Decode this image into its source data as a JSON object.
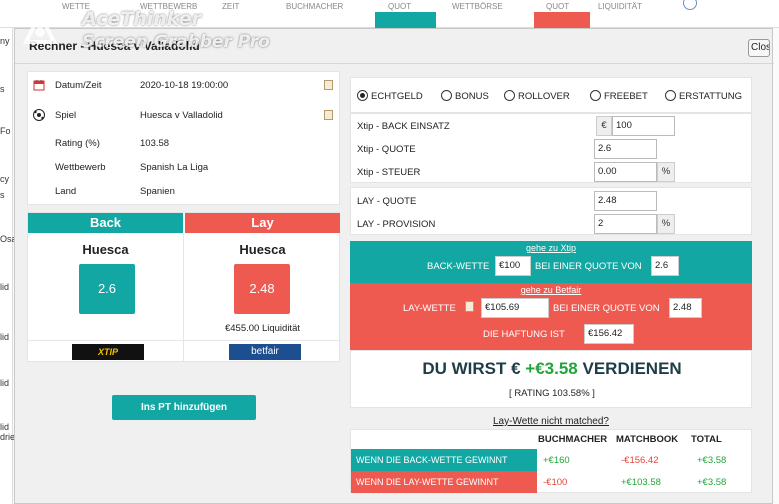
{
  "background": {
    "headers": [
      "WETTE",
      "WETTBEWERB",
      "ZEIT",
      "BUCHMACHER",
      "QUOT",
      "WETTBÖRSE",
      "QUOT",
      "LIQUIDITÄT"
    ],
    "side_fragments": [
      "ny",
      "s",
      "Fo",
      "cy",
      "s",
      "Osa",
      "lid",
      "lid",
      "lid",
      "lid",
      "drie"
    ]
  },
  "watermark": {
    "line1": "AceThinker",
    "line2": "Screen Grabber Pro"
  },
  "dialog": {
    "title": "Rechner - Huesca v Valladolid",
    "close_label": "Close"
  },
  "info": {
    "rows": [
      {
        "label": "Datum/Zeit",
        "value": "2020-10-18 19:00:00",
        "icon": "calendar-icon"
      },
      {
        "label": "Spiel",
        "value": "Huesca v Valladolid",
        "icon": "soccer-ball-icon"
      },
      {
        "label": "Rating (%)",
        "value": "103.58"
      },
      {
        "label": "Wettbewerb",
        "value": "Spanish La Liga"
      },
      {
        "label": "Land",
        "value": "Spanien"
      }
    ]
  },
  "backlay": {
    "back_header": "Back",
    "lay_header": "Lay",
    "back_team": "Huesca",
    "lay_team": "Huesca",
    "back_odds": "2.6",
    "lay_odds": "2.48",
    "lay_liquidity": "€455.00 Liquidität",
    "bookmaker_logo": "XTIP",
    "exchange_logo": "betfair",
    "colors": {
      "back": "#12a7a3",
      "lay": "#ef5a50"
    }
  },
  "add_button": "Ins PT hinzufügen",
  "bet_types": {
    "options": [
      "ECHTGELD",
      "BONUS",
      "ROLLOVER",
      "FREEBET",
      "ERSTATTUNG"
    ],
    "selected": "ECHTGELD"
  },
  "form": {
    "back_stake_label": "Xtip - BACK EINSATZ",
    "back_stake_prefix": "€",
    "back_stake_value": "100",
    "back_odds_label": "Xtip - QUOTE",
    "back_odds_value": "2.6",
    "back_tax_label": "Xtip - STEUER",
    "back_tax_value": "0.00",
    "back_tax_suffix": "%",
    "lay_odds_label": "LAY - QUOTE",
    "lay_odds_value": "2.48",
    "lay_commission_label": "LAY - PROVISION",
    "lay_commission_value": "2",
    "lay_commission_suffix": "%"
  },
  "calc": {
    "goto_back_link": "gehe zu Xtip",
    "back_bet_label": "BACK-WETTE",
    "back_bet_value": "€100",
    "back_at_odds_label": "BEI EINER QUOTE VON",
    "back_at_odds_value": "2.6",
    "goto_lay_link": "gehe zu Betfair",
    "lay_bet_label": "LAY-WETTE",
    "lay_bet_value": "€105.69",
    "lay_at_odds_label": "BEI EINER QUOTE VON",
    "lay_at_odds_value": "2.48",
    "liability_label": "DIE HAFTUNG IST",
    "liability_value": "€156.42"
  },
  "result": {
    "prefix": "DU WIRST €",
    "amount": "+€3.58",
    "suffix": "VERDIENEN",
    "rating": "[ RATING 103.58% ]"
  },
  "not_matched_link": "Lay-Wette nicht matched?",
  "scenarios": {
    "headers": [
      "BUCHMACHER",
      "MATCHBOOK",
      "TOTAL"
    ],
    "rows": [
      {
        "label": "WENN DIE BACK-WETTE GEWINNT",
        "bookmaker": "+€160",
        "matchbook": "-€156.42",
        "total": "+€3.58"
      },
      {
        "label": "WENN DIE LAY-WETTE GEWINNT",
        "bookmaker": "-€100",
        "matchbook": "+€103.58",
        "total": "+€3.58"
      }
    ]
  }
}
